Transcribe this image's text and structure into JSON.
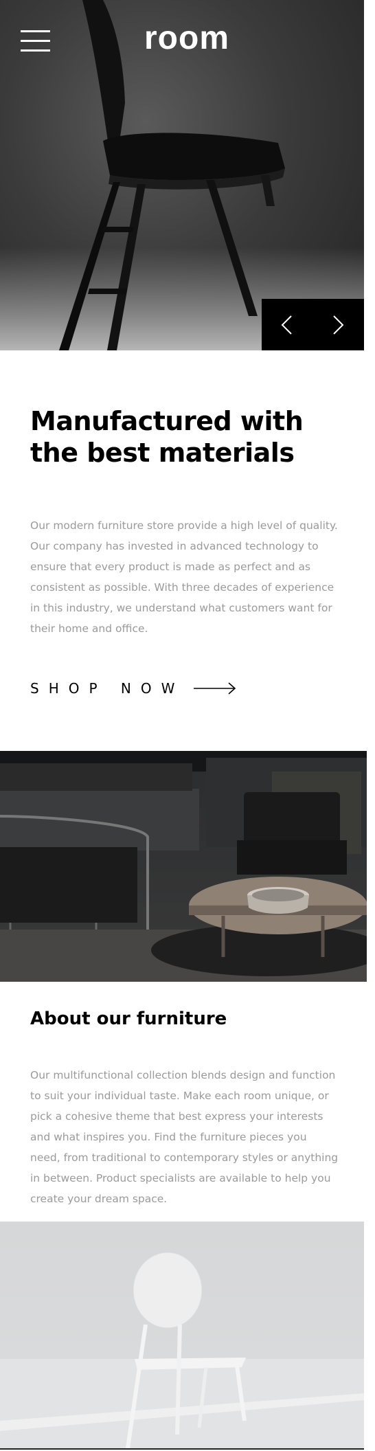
{
  "header": {
    "logo": "room",
    "menu_icon": "hamburger-icon"
  },
  "hero": {
    "image": "folding-chair-photo",
    "prev_icon": "chevron-left-icon",
    "next_icon": "chevron-right-icon"
  },
  "intro": {
    "title_line1": "Manufactured with",
    "title_line2": "the best materials",
    "description": "Our modern furniture store provide a high level of quality. Our company has invested in advanced technology to ensure that every product is made as perfect and as consistent as possible. With three decades of experience in this industry, we understand what customers want for their home and office.",
    "cta_label": "SHOP NOW",
    "cta_icon": "arrow-right-icon"
  },
  "about": {
    "image_top": "dark-living-room-photo",
    "title": "About our furniture",
    "description": "Our multifunctional collection blends design and function to suit your individual taste. Make each room unique, or pick a cohesive theme that best express your interests and what inspires you. Find the furniture pieces you need, from traditional to contemporary styles or anything in between. Product specialists are available to help you create your dream space.",
    "image_bottom": "white-chair-photo"
  }
}
